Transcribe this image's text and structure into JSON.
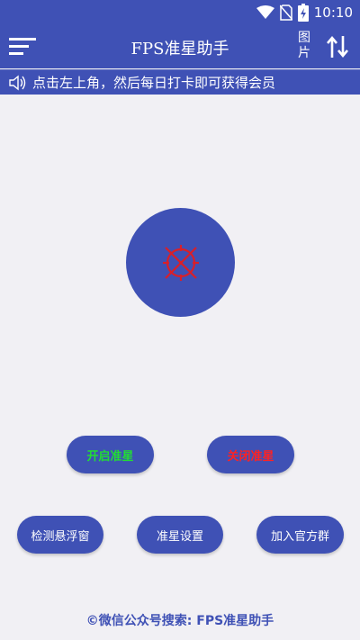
{
  "status_bar": {
    "time": "10:10"
  },
  "app_bar": {
    "title": "FPS准星助手",
    "picture_label_line1": "图",
    "picture_label_line2": "片"
  },
  "notice": {
    "text": "点击左上角，然后每日打卡即可获得会员"
  },
  "buttons": {
    "open_crosshair": "开启准星",
    "close_crosshair": "关闭准星",
    "check_float": "检测悬浮窗",
    "crosshair_settings": "准星设置",
    "join_group": "加入官方群"
  },
  "footer": {
    "text": "©微信公众号搜索: FPS准星助手"
  },
  "colors": {
    "primary": "#3f51b5",
    "background": "#f1f0f4",
    "open_label": "#22dd33",
    "close_label": "#ff2222",
    "crosshair": "#d8202a"
  }
}
